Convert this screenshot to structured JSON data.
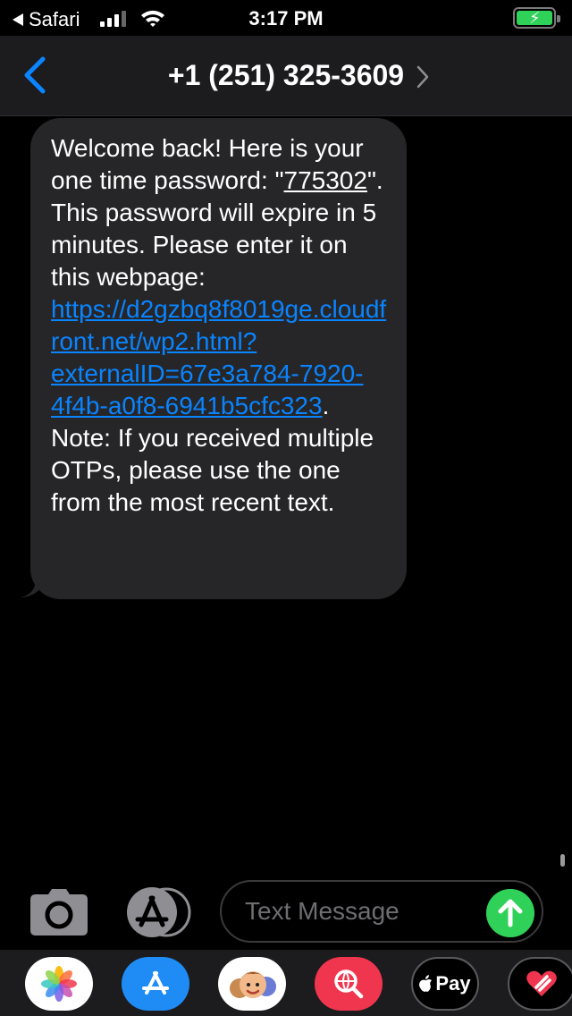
{
  "status_bar": {
    "back_app": "Safari",
    "time": "3:17 PM",
    "battery_charging": true
  },
  "nav": {
    "contact": "+1 (251) 325-3609"
  },
  "message": {
    "p1": "Welcome back! Here is your one time password: \"",
    "otp": "775302",
    "p2": "\". This password will expire in 5 minutes. Please enter it on this webpage: ",
    "link": "https://d2gzbq8f8019ge.cloudfront.net/wp2.html?externalID=67e3a784-7920-4f4b-a0f8-6941b5cfc323",
    "p3": ". Note: If you received multiple OTPs, please use the one from the most recent text."
  },
  "composer": {
    "placeholder": "Text Message",
    "value": ""
  },
  "app_drawer": {
    "apps": [
      {
        "name": "photos-app-icon"
      },
      {
        "name": "app-store-icon"
      },
      {
        "name": "memoji-icon"
      },
      {
        "name": "web-search-icon"
      },
      {
        "name": "apple-pay-icon",
        "label": "Pay"
      },
      {
        "name": "digital-touch-icon"
      }
    ]
  },
  "colors": {
    "link": "#0a84ff",
    "send": "#30d158",
    "bubble": "#262628",
    "nav_background": "#1c1c1e"
  }
}
